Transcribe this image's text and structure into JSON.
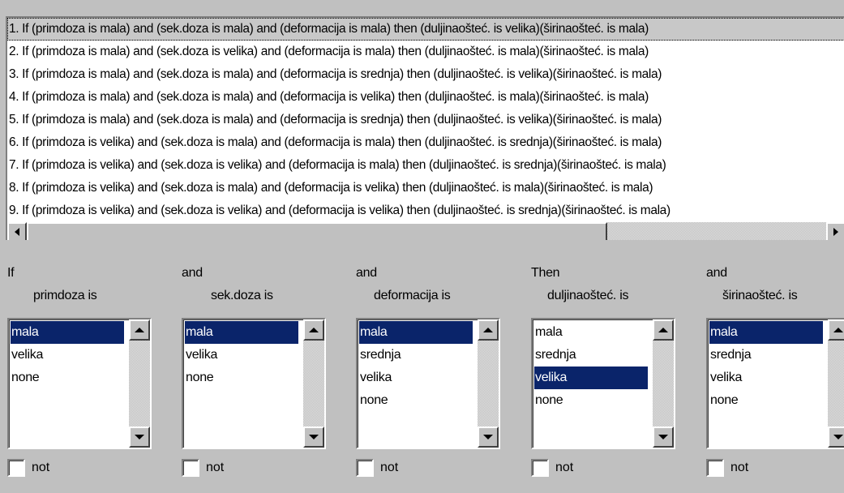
{
  "rules": [
    "1. If (primdoza is mala) and (sek.doza is mala) and (deformacija is mala) then (duljinaošteć. is velika)(širinaošteć. is mala)",
    "2. If (primdoza is mala) and (sek.doza is velika) and (deformacija is mala) then (duljinaošteć. is mala)(širinaošteć. is mala)",
    "3. If (primdoza is mala) and (sek.doza is mala) and (deformacija is srednja) then (duljinaošteć. is velika)(širinaošteć. is mala)",
    "4. If (primdoza is mala) and (sek.doza is mala) and (deformacija is velika) then (duljinaošteć. is mala)(širinaošteć. is mala)",
    "5. If (primdoza is mala) and (sek.doza is mala) and (deformacija is srednja) then (duljinaošteć. is velika)(širinaošteć. is mala)",
    "6. If (primdoza is velika) and (sek.doza is mala) and (deformacija is mala) then (duljinaošteć. is srednja)(širinaošteć. is mala)",
    "7. If (primdoza is velika) and (sek.doza is velika) and (deformacija is mala) then (duljinaošteć. is srednja)(širinaošteć. is mala)",
    "8. If (primdoza is velika) and (sek.doza is mala) and (deformacija is velika) then (duljinaošteć. is mala)(širinaošteć. is mala)",
    "9. If (primdoza is velika) and (sek.doza is velika) and (deformacija is velika) then (duljinaošteć. is srednja)(širinaošteć. is mala)"
  ],
  "selected_rule_index": 0,
  "columns": [
    {
      "connector": "If",
      "variable": "primdoza is",
      "options": [
        "mala",
        "velika",
        "none"
      ],
      "selected_index": 0,
      "not_label": "not",
      "not_checked": false
    },
    {
      "connector": "and",
      "variable": "sek.doza is",
      "options": [
        "mala",
        "velika",
        "none"
      ],
      "selected_index": 0,
      "not_label": "not",
      "not_checked": false
    },
    {
      "connector": "and",
      "variable": "deformacija is",
      "options": [
        "mala",
        "srednja",
        "velika",
        "none"
      ],
      "selected_index": 0,
      "not_label": "not",
      "not_checked": false
    },
    {
      "connector": "Then",
      "variable": "duljinaošteć. is",
      "options": [
        "mala",
        "srednja",
        "velika",
        "none"
      ],
      "selected_index": 2,
      "not_label": "not",
      "not_checked": false
    },
    {
      "connector": "and",
      "variable": "širinaošteć. is",
      "options": [
        "mala",
        "srednja",
        "velika",
        "none"
      ],
      "selected_index": 0,
      "not_label": "not",
      "not_checked": false
    }
  ],
  "colors": {
    "background": "#c0c0c0",
    "selection": "#0a246a",
    "rule_selection": "#c8c8c8"
  }
}
